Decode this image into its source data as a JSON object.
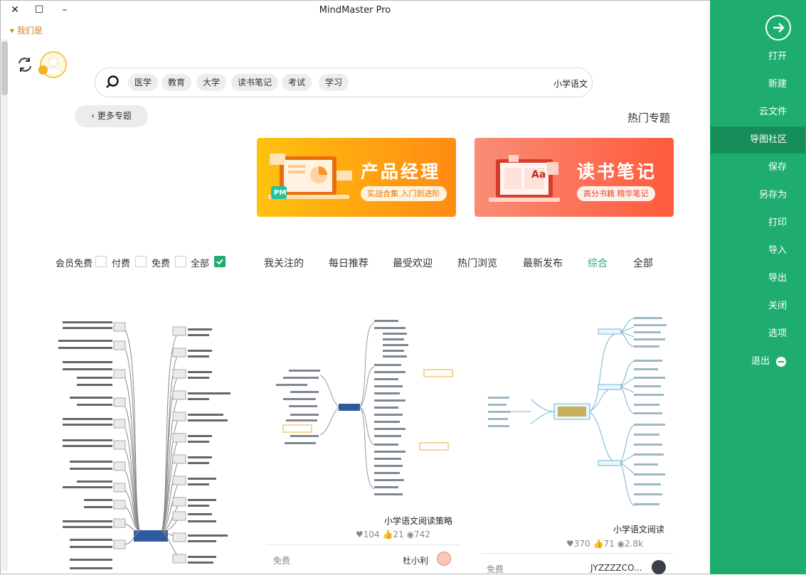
{
  "window": {
    "title": "MindMaster Pro",
    "close_glyph": "✕",
    "maximize_glyph": "☐",
    "minimize_glyph": "–",
    "user_link": "我们是"
  },
  "search": {
    "query": "小学语文",
    "tags": [
      "学习",
      "考试",
      "读书笔记",
      "大学",
      "教育",
      "医学"
    ]
  },
  "topics": {
    "more_button": "更多专题",
    "heading": "热门专题"
  },
  "banners": [
    {
      "title": "读书笔记",
      "subtitle": "高分书籍 精华笔记",
      "icon_text": "Aa"
    },
    {
      "title": "产品经理",
      "subtitle": "实战合集 入门到进阶",
      "icon_text": "PM"
    }
  ],
  "filter_nav": {
    "items": [
      "全部",
      "综合",
      "最新发布",
      "热门浏览",
      "最受欢迎",
      "每日推荐",
      "我关注的"
    ],
    "active": "综合"
  },
  "price_filter": {
    "options": [
      {
        "label": "全部",
        "checked": true
      },
      {
        "label": "免费",
        "checked": false
      },
      {
        "label": "付费",
        "checked": false
      },
      {
        "label": "会员免费",
        "checked": false
      }
    ]
  },
  "cards": [
    {
      "title": "小学语文阅读",
      "views": "2.8k",
      "likes": "71",
      "favorites": "370",
      "author": "JYZZZZCO...",
      "price": "免费"
    },
    {
      "title": "小学语文阅读策略",
      "views": "742",
      "likes": "21",
      "favorites": "104",
      "author": "杜小利",
      "price": "免费"
    },
    {
      "title": "",
      "views": "",
      "likes": "",
      "favorites": "",
      "author": "",
      "price": ""
    }
  ],
  "sidebar": {
    "items": [
      "打开",
      "新建",
      "云文件",
      "导图社区",
      "保存",
      "另存为",
      "打印",
      "导入",
      "导出",
      "关闭",
      "选项",
      "退出"
    ],
    "active": "导图社区"
  },
  "colors": {
    "accent": "#1fad6f",
    "sidebar_active": "#168e5a",
    "product_banner": "#ff9a12",
    "reading_banner": "#ff6a4a"
  }
}
